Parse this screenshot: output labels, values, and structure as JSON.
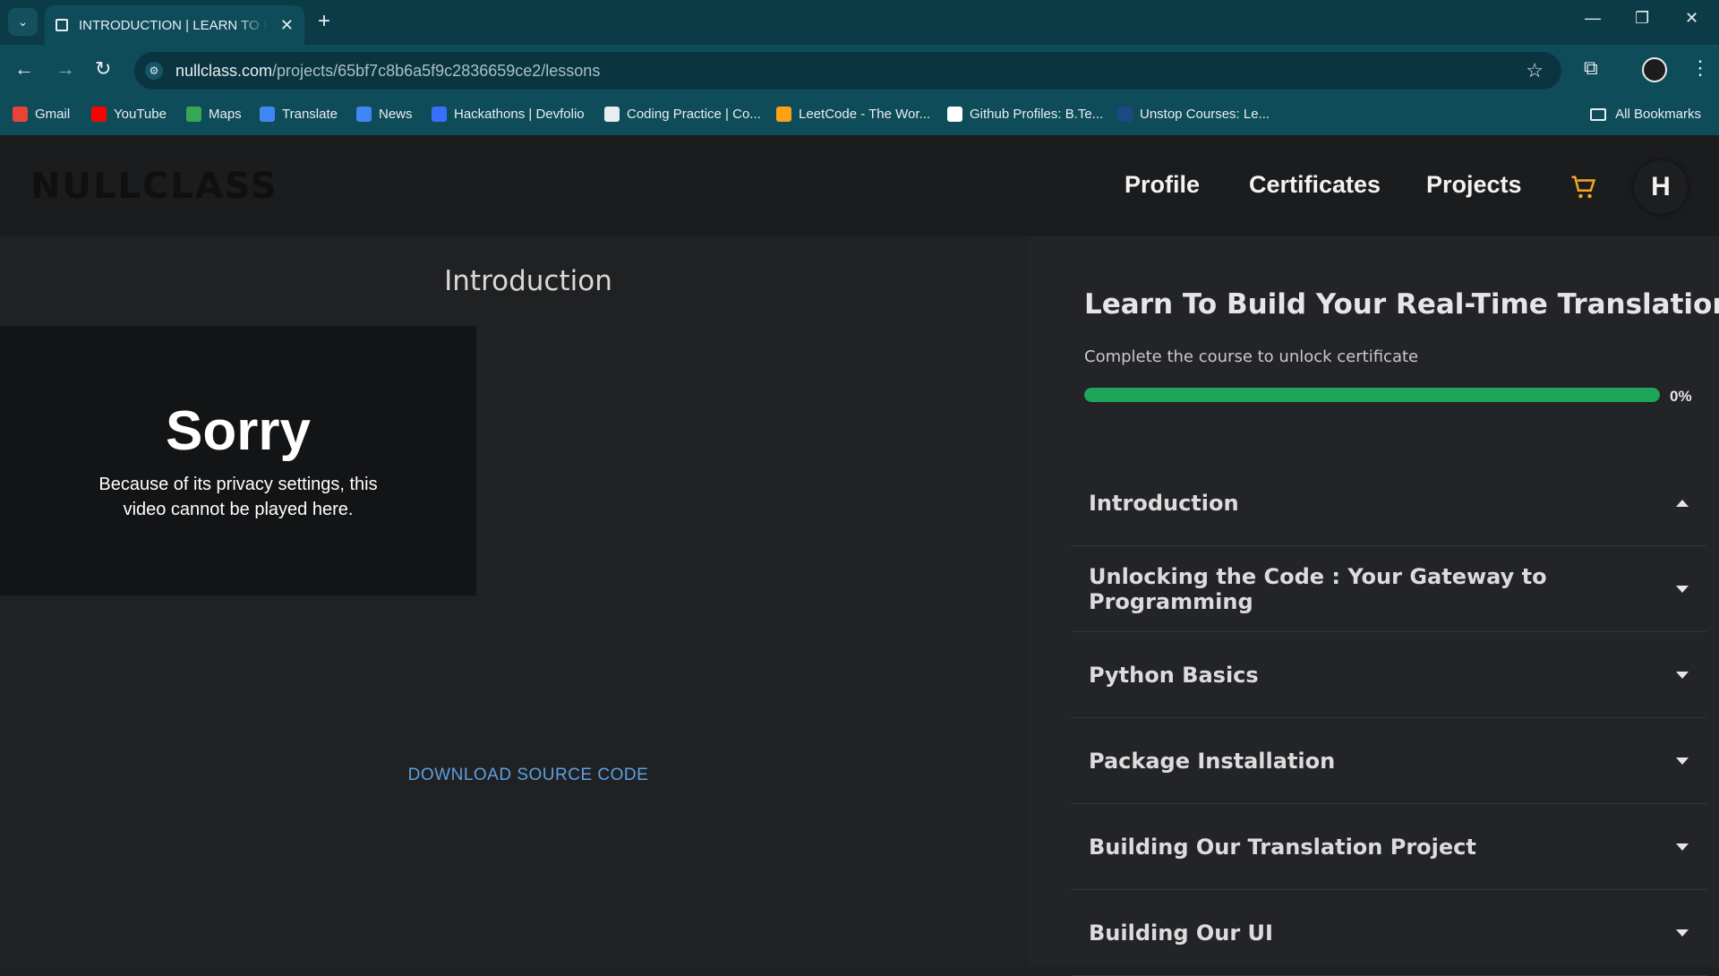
{
  "browser": {
    "tab_title": "INTRODUCTION | LEARN TO BUILD YOUR REAL-TIME TRANSLATION APP",
    "url_host": "nullclass.com",
    "url_path": "/projects/65bf7c8b6a5f9c2836659ce2/lessons",
    "bookmarks": [
      {
        "label": "Gmail",
        "color": "#ea4335"
      },
      {
        "label": "YouTube",
        "color": "#ff0000"
      },
      {
        "label": "Maps",
        "color": "#34a853"
      },
      {
        "label": "Translate",
        "color": "#4285f4"
      },
      {
        "label": "News",
        "color": "#4285f4"
      },
      {
        "label": "Hackathons | Devfolio",
        "color": "#3770ff"
      },
      {
        "label": "Coding Practice | Co...",
        "color": "#e8eef0"
      },
      {
        "label": "LeetCode - The Wor...",
        "color": "#ffa116"
      },
      {
        "label": "Github Profiles: B.Te...",
        "color": "#ffffff"
      },
      {
        "label": "Unstop Courses: Le...",
        "color": "#1c4980"
      }
    ],
    "all_bookmarks": "All Bookmarks"
  },
  "header": {
    "logo": "NULLCLASS",
    "nav": [
      "Profile",
      "Certificates",
      "Projects"
    ],
    "avatar_letter": "H",
    "cart_color": "#f5a623"
  },
  "lesson": {
    "title": "Introduction",
    "video_heading": "Sorry",
    "video_message": "Because of its privacy settings, this video cannot be played here.",
    "download_label": "DOWNLOAD SOURCE CODE"
  },
  "course": {
    "title": "Learn To Build Your Real-Time Translation App",
    "subtitle": "Complete the course to unlock certificate",
    "progress_percent": 0,
    "progress_label": "0%",
    "sections": [
      {
        "label": "Introduction",
        "expanded": true
      },
      {
        "label": "Unlocking the Code : Your Gateway to Programming",
        "expanded": false
      },
      {
        "label": "Python Basics",
        "expanded": false
      },
      {
        "label": "Package Installation",
        "expanded": false
      },
      {
        "label": "Building Our Translation Project",
        "expanded": false
      },
      {
        "label": "Building Our UI",
        "expanded": false
      }
    ]
  }
}
